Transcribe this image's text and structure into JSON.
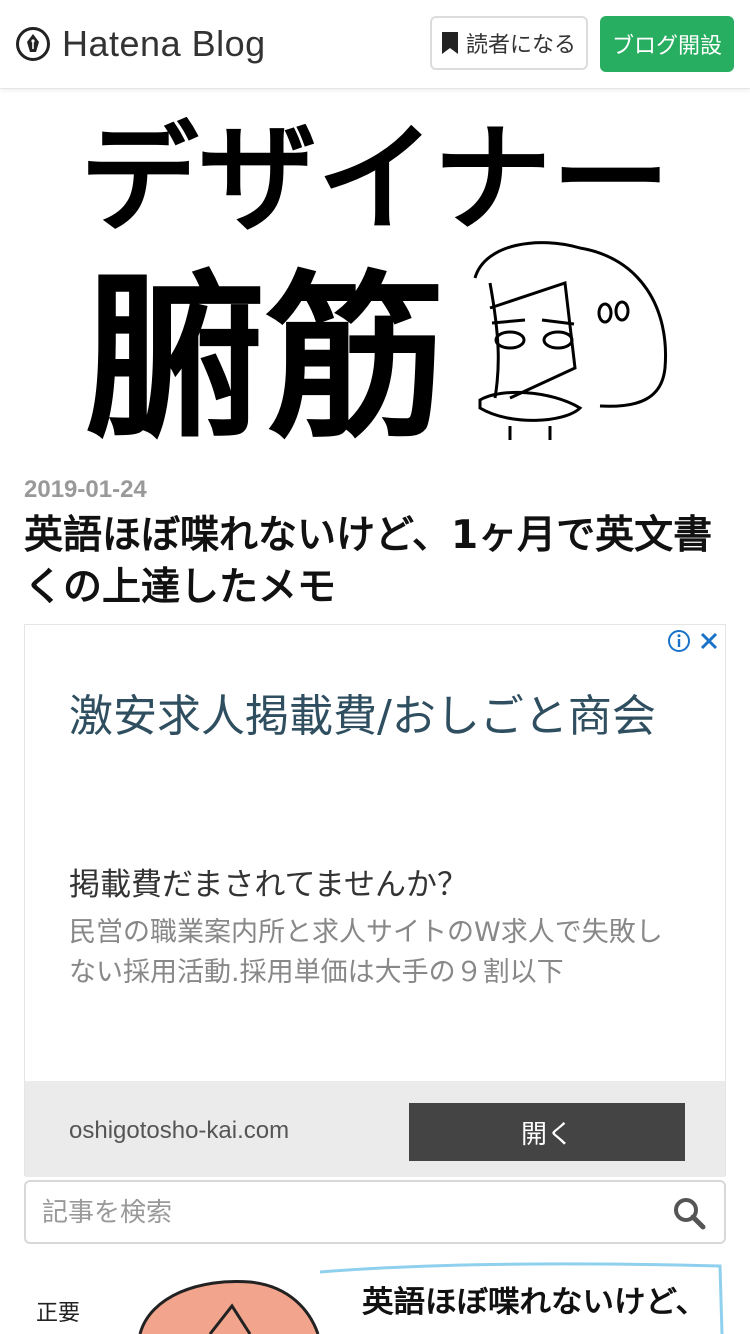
{
  "header": {
    "brand": "Hatena Blog",
    "reader_button": "読者になる",
    "open_blog_button": "ブログ開設"
  },
  "banner": {
    "line1": "デザイナー",
    "line2": "腑筋"
  },
  "article": {
    "date": "2019-01-24",
    "title": "英語ほぼ喋れないけど、1ヶ月で英文書くの上達したメモ"
  },
  "ad": {
    "headline": "激安求人掲載費/おしごと商会",
    "subheadline": "掲載費だまされてませんか？",
    "description": "民営の職業案内所と求人サイトのW求人で失敗しない採用活動.採用単価は大手の９割以下",
    "url": "oshigotosho-kai.com",
    "cta": "開く",
    "icon_color": "#1a73c8"
  },
  "search": {
    "placeholder": "記事を検索"
  },
  "illustration": {
    "caption": "英語ほぼ喋れないけど、",
    "side_text": "正要"
  },
  "colors": {
    "accent_green": "#27ae60",
    "ad_button": "#444444"
  }
}
